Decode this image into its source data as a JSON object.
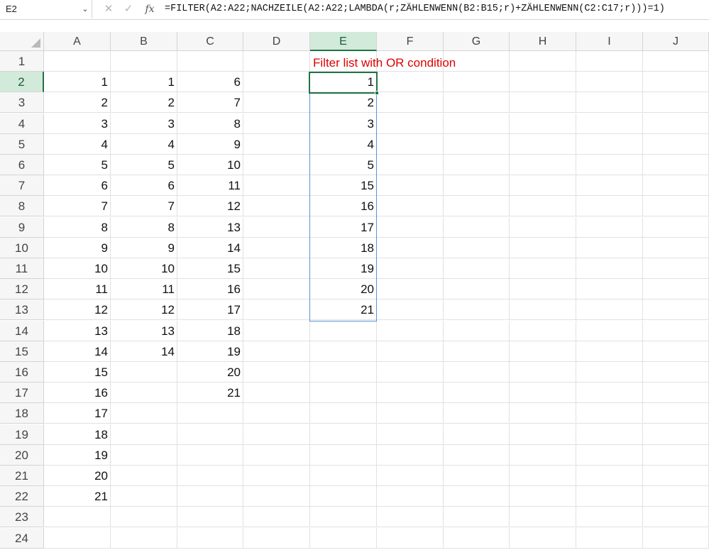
{
  "formula_bar": {
    "name_box": "E2",
    "cancel_icon": "close-icon",
    "confirm_icon": "check-icon",
    "fx_label": "fx",
    "formula": "=FILTER(A2:A22;NACHZEILE(A2:A22;LAMBDA(r;ZÄHLENWENN(B2:B15;r)+ZÄHLENWENN(C2:C17;r)))=1)"
  },
  "columns": [
    "A",
    "B",
    "C",
    "D",
    "E",
    "F",
    "G",
    "H",
    "I",
    "J"
  ],
  "selected_column": "E",
  "rows": [
    "1",
    "2",
    "3",
    "4",
    "5",
    "6",
    "7",
    "8",
    "9",
    "10",
    "11",
    "12",
    "13",
    "14",
    "15",
    "16",
    "17",
    "18",
    "19",
    "20",
    "21",
    "22",
    "23",
    "24"
  ],
  "selected_row": "2",
  "active_cell": "E2",
  "title": "Filter list with OR condition",
  "colors": {
    "selection_green": "#217346",
    "header_highlight": "#d2ead9",
    "title_red": "#e00000",
    "spill_border": "#5b8fd6"
  },
  "cells": {
    "A": [
      "1",
      "2",
      "3",
      "4",
      "5",
      "6",
      "7",
      "8",
      "9",
      "10",
      "11",
      "12",
      "13",
      "14",
      "15",
      "16",
      "17",
      "18",
      "19",
      "20",
      "21"
    ],
    "B": [
      "1",
      "2",
      "3",
      "4",
      "5",
      "6",
      "7",
      "8",
      "9",
      "10",
      "11",
      "12",
      "13",
      "14"
    ],
    "C": [
      "6",
      "7",
      "8",
      "9",
      "10",
      "11",
      "12",
      "13",
      "14",
      "15",
      "16",
      "17",
      "18",
      "19",
      "20",
      "21"
    ],
    "E": [
      "1",
      "2",
      "3",
      "4",
      "5",
      "15",
      "16",
      "17",
      "18",
      "19",
      "20",
      "21"
    ]
  }
}
